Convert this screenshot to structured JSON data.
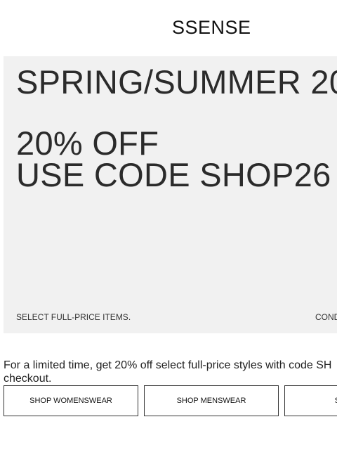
{
  "header": {
    "logo": "SSENSE"
  },
  "hero": {
    "season_title": "SPRING/SUMMER 20",
    "offer_line1": "20% OFF",
    "offer_line2": "USE CODE SHOP26",
    "footnote": "SELECT FULL-PRICE ITEMS.",
    "conditions_link": "COND"
  },
  "promo": {
    "line1": "For a limited time, get 20% off select full-price styles with code SH",
    "line2": "checkout."
  },
  "shop_buttons": [
    {
      "label": "SHOP WOMENSWEAR"
    },
    {
      "label": "SHOP MENSWEAR"
    },
    {
      "label": "SHOP EV"
    }
  ],
  "colors": {
    "hero_background": "#f1f1f1",
    "text": "#222222",
    "button_border": "#333333"
  }
}
